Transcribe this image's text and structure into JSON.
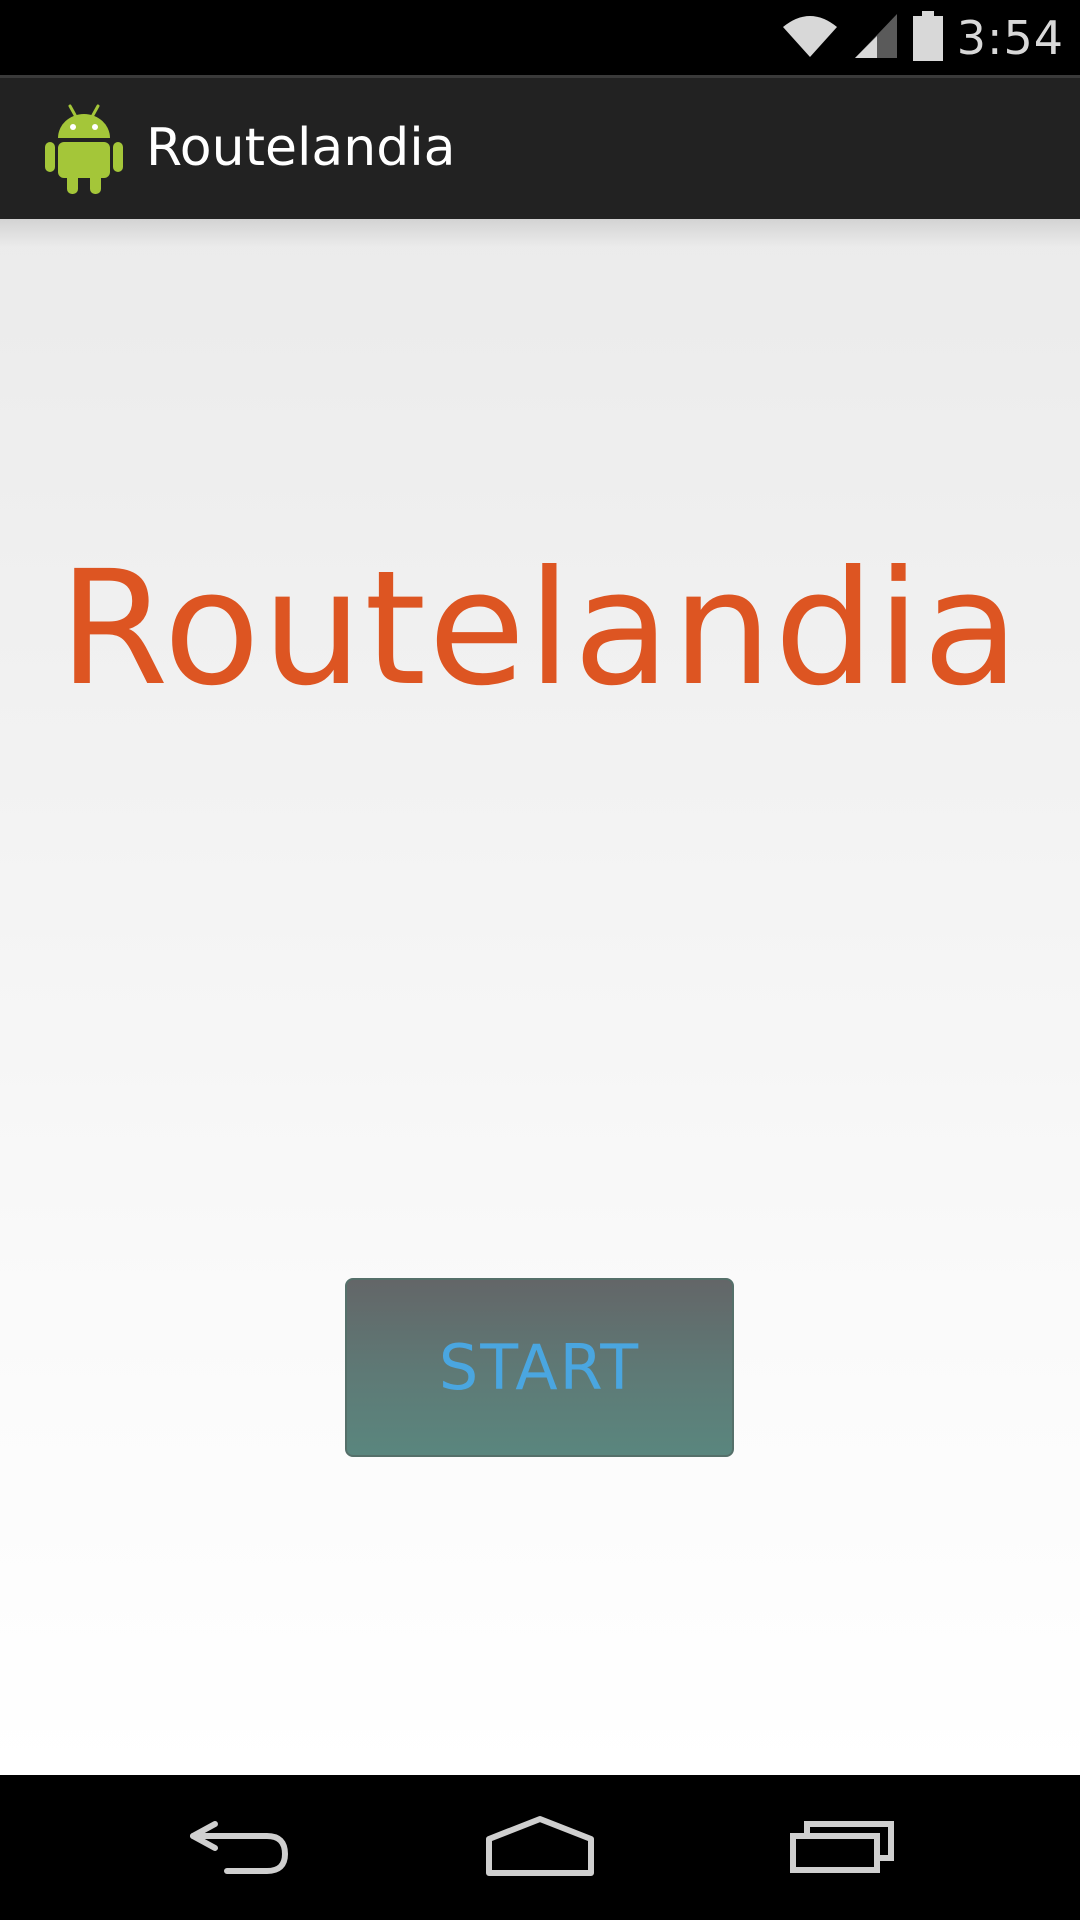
{
  "status_bar": {
    "time": "3:54",
    "icons": [
      "wifi-icon",
      "cell-signal-icon",
      "battery-icon"
    ]
  },
  "action_bar": {
    "title": "Routelandia",
    "icon": "android-app-icon"
  },
  "main": {
    "headline": "Routelandia",
    "start_button_label": "START"
  },
  "navigation": {
    "icons": [
      "back-icon",
      "home-icon",
      "recent-apps-icon"
    ]
  },
  "colors": {
    "headline": "#dd5522",
    "button_text": "#4aa6e0",
    "action_bar": "#222222",
    "android_green": "#a4c639"
  }
}
